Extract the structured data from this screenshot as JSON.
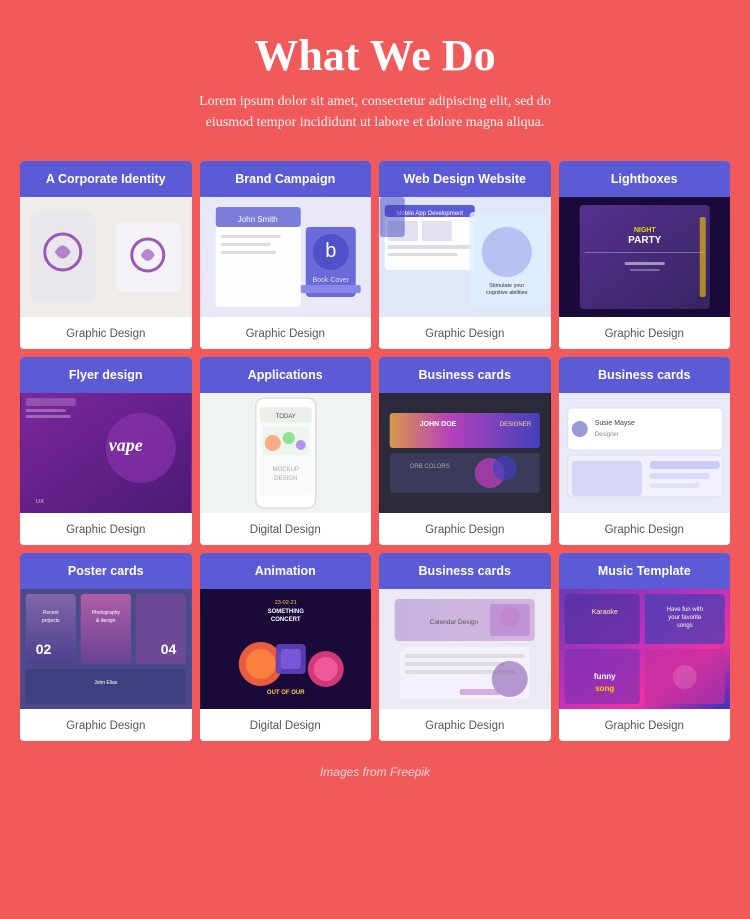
{
  "header": {
    "title": "What We Do",
    "subtitle": "Lorem ipsum dolor sit amet, consectetur adipiscing elit, sed do eiusmod tempor incididunt ut labore et dolore magna aliqua."
  },
  "footer": {
    "note": "Images from Freepik"
  },
  "grid": {
    "rows": [
      [
        {
          "title": "A Corporate Identity",
          "category": "Graphic Design",
          "img_class": "img-corporate"
        },
        {
          "title": "Brand Campaign",
          "category": "Graphic Design",
          "img_class": "img-brand"
        },
        {
          "title": "Web Design Website",
          "category": "Graphic Design",
          "img_class": "img-web"
        },
        {
          "title": "Lightboxes",
          "category": "Graphic Design",
          "img_class": "img-lightbox"
        }
      ],
      [
        {
          "title": "Flyer design",
          "category": "Graphic Design",
          "img_class": "img-flyer"
        },
        {
          "title": "Applications",
          "category": "Digital Design",
          "img_class": "img-apps"
        },
        {
          "title": "Business cards",
          "category": "Graphic Design",
          "img_class": "img-bizcard1"
        },
        {
          "title": "Business cards",
          "category": "Graphic Design",
          "img_class": "img-bizcard2"
        }
      ],
      [
        {
          "title": "Poster cards",
          "category": "Graphic Design",
          "img_class": "img-poster"
        },
        {
          "title": "Animation",
          "category": "Digital Design",
          "img_class": "img-animation"
        },
        {
          "title": "Business cards",
          "category": "Graphic Design",
          "img_class": "img-bizcard3"
        },
        {
          "title": "Music Template",
          "category": "Graphic Design",
          "img_class": "img-music"
        }
      ]
    ]
  }
}
